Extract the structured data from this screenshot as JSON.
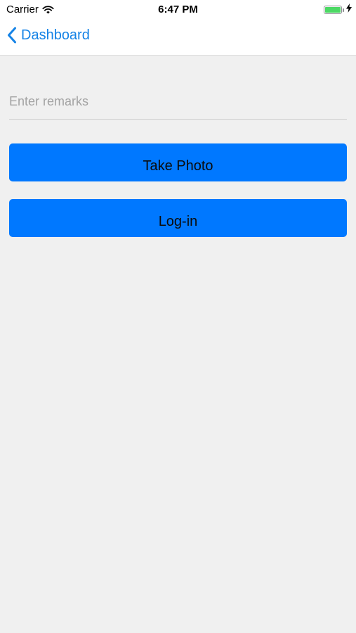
{
  "status_bar": {
    "carrier": "Carrier",
    "time": "6:47 PM",
    "battery_level": 1.0,
    "charging": true,
    "icons": [
      "wifi-icon",
      "battery-icon",
      "charging-bolt-icon"
    ]
  },
  "nav": {
    "back_label": "Dashboard",
    "back_icon": "chevron-left-icon",
    "tint_color": "#1583e6"
  },
  "form": {
    "remarks_value": "",
    "remarks_placeholder": "Enter remarks"
  },
  "buttons": {
    "take_photo_label": "Take Photo",
    "login_label": "Log-in",
    "button_color": "#0078ff"
  },
  "colors": {
    "background": "#f0f0f0",
    "battery_fill": "#4cd964"
  }
}
